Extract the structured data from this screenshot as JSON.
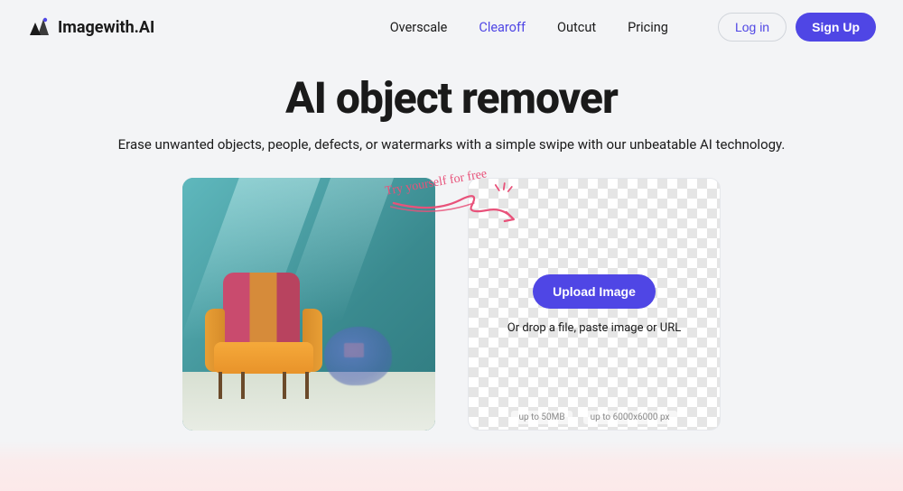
{
  "brand": {
    "name": "Imagewith.AI"
  },
  "nav": {
    "items": [
      {
        "label": "Overscale",
        "active": false
      },
      {
        "label": "Clearoff",
        "active": true
      },
      {
        "label": "Outcut",
        "active": false
      },
      {
        "label": "Pricing",
        "active": false
      }
    ]
  },
  "auth": {
    "login_label": "Log in",
    "signup_label": "Sign Up"
  },
  "hero": {
    "title": "AI object remover",
    "subtitle": "Erase unwanted objects, people, defects, or watermarks with a simple swipe with our unbeatable AI technology."
  },
  "annotation": {
    "text": "Try yourself for free"
  },
  "upload": {
    "button_label": "Upload Image",
    "drop_text": "Or drop a file, paste image or URL",
    "limits": {
      "size": "up to 50MB",
      "dimensions": "up to 6000x6000 px"
    }
  },
  "colors": {
    "primary": "#4f46e5",
    "annotation": "#e8527a"
  }
}
